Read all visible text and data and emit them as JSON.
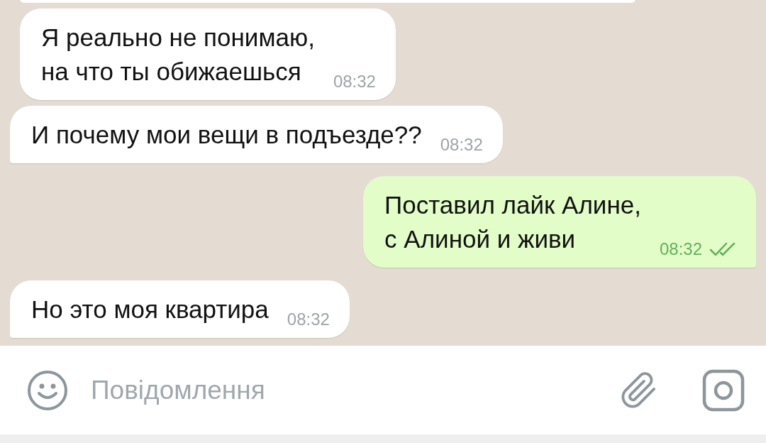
{
  "messages": [
    {
      "outgoing": false,
      "tail": false,
      "text": "Я реально не понимаю,\nна что ты обижаешься",
      "time": "08:32"
    },
    {
      "outgoing": false,
      "tail": true,
      "text": "И почему мои вещи в подъезде??",
      "time": "08:32"
    },
    {
      "outgoing": true,
      "tail": true,
      "text": "Поставил лайк Алине,\nс Алиной и живи",
      "time": "08:32",
      "read": true
    },
    {
      "outgoing": false,
      "tail": true,
      "text": "Но это моя квартира",
      "time": "08:32"
    }
  ],
  "composer": {
    "placeholder": "Повідомлення"
  }
}
